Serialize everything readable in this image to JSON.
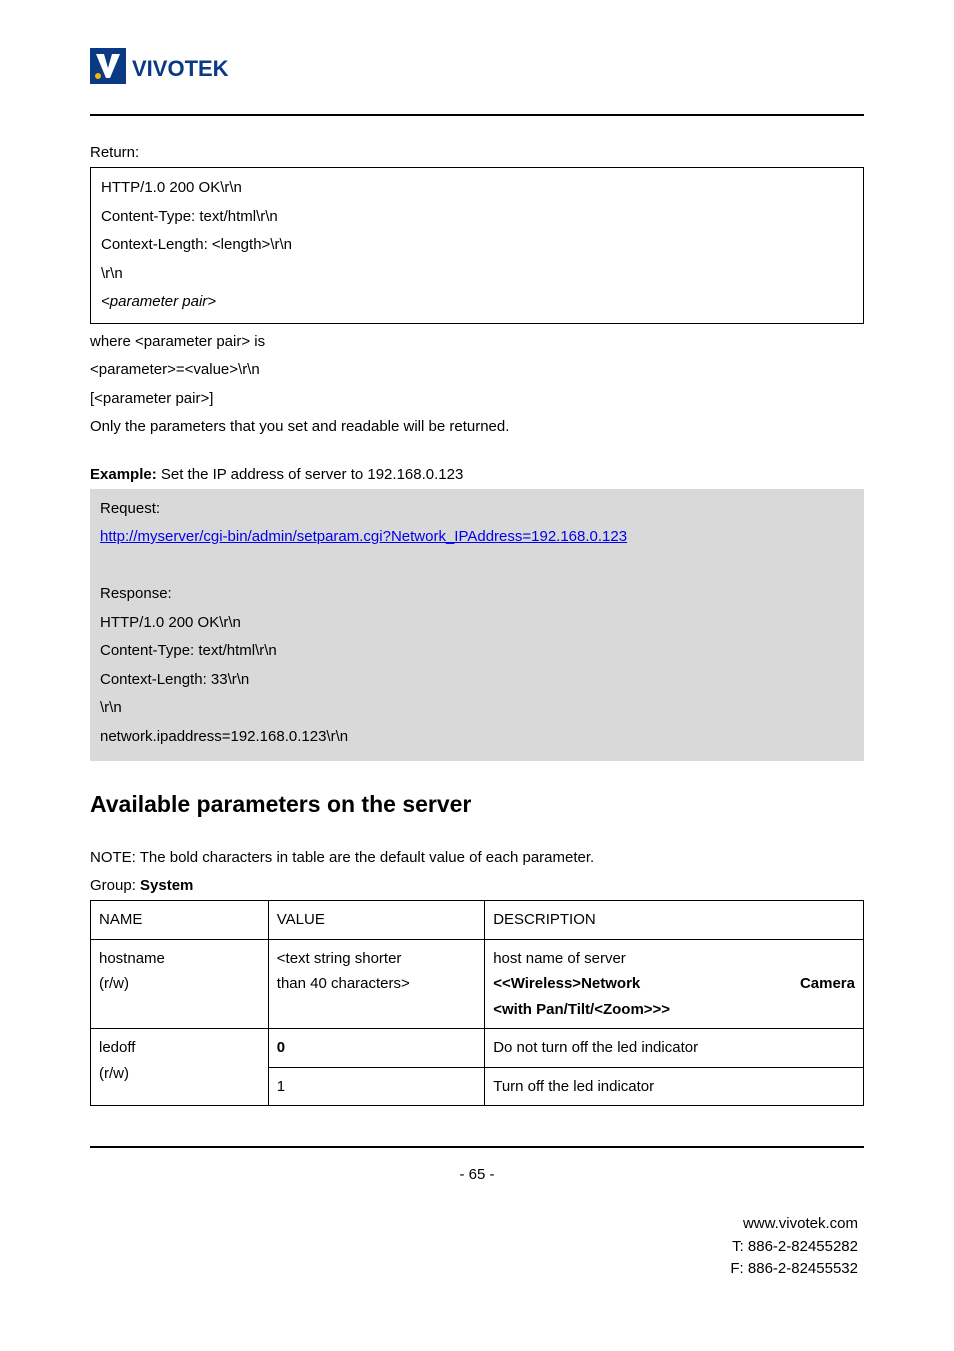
{
  "logo_alt": "VIVOTEK",
  "return_label": "Return:",
  "return_box": {
    "l1": "HTTP/1.0 200 OK\\r\\n",
    "l2": "Content-Type: text/html\\r\\n",
    "l3": "Context-Length: <length>\\r\\n",
    "l4": "\\r\\n",
    "l5": "<parameter pair>"
  },
  "after_box": {
    "l1": "where <parameter pair> is",
    "l2": "<parameter>=<value>\\r\\n",
    "l3": "[<parameter pair>]",
    "l4": "Only the parameters that you set and readable will be returned."
  },
  "example_label_prefix": "Example:",
  "example_label_rest": " Set the IP address of server to 192.168.0.123",
  "gray": {
    "req_label": "Request:",
    "req_url": "http://myserver/cgi-bin/admin/setparam.cgi?Network_IPAddress=192.168.0.123",
    "resp_label": "Response:",
    "r1": "HTTP/1.0 200 OK\\r\\n",
    "r2": "Content-Type: text/html\\r\\n",
    "r3": "Context-Length: 33\\r\\n",
    "r4": "\\r\\n",
    "r5": "network.ipaddress=192.168.0.123\\r\\n"
  },
  "section_heading": "Available parameters on the server",
  "note_text": "NOTE: The bold characters in table are the default value of each parameter.",
  "group_prefix": "Group: ",
  "group_name": "System",
  "table": {
    "head": {
      "name": "NAME",
      "value": "VALUE",
      "desc": "DESCRIPTION"
    },
    "rows": [
      {
        "name_l1": "hostname",
        "name_l2": "(r/w)",
        "value_l1": "<text string shorter",
        "value_l2": "than 40 characters>",
        "desc_l1": "host name of server",
        "desc_l2_bold_a": "<<Wireless>Network",
        "desc_l2_bold_b": "Camera",
        "desc_l3_bold": "<with Pan/Tilt/<Zoom>>>"
      },
      {
        "name": "ledoff",
        "name2": "(r/w)",
        "value_a": "0",
        "value_b": "1",
        "desc_a": "Do not turn off the led indicator",
        "desc_b": "Turn off the led indicator"
      }
    ]
  },
  "page_number": "- 65 -",
  "footer": {
    "l1": "www.vivotek.com",
    "l2": "T: 886-2-82455282",
    "l3": "F: 886-2-82455532"
  }
}
